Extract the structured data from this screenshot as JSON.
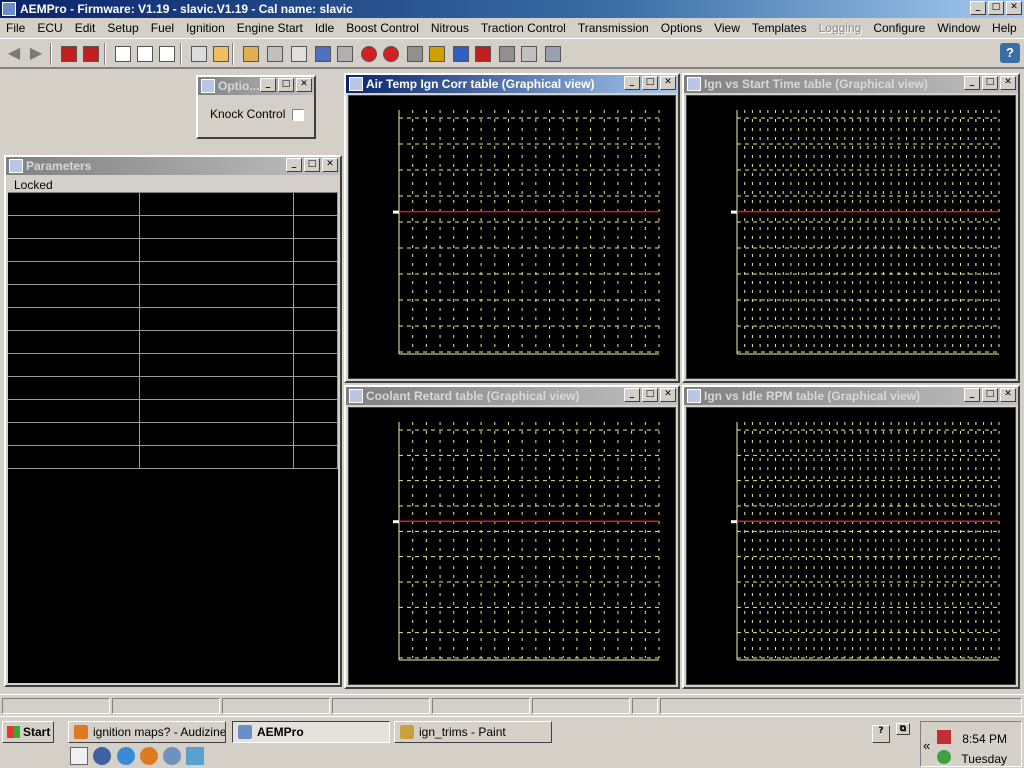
{
  "window": {
    "title": "AEMPro - Firmware: V1.19 - slavic.V1.19 - Cal name: slavic",
    "controls": [
      "_",
      "□",
      "✕"
    ]
  },
  "menu": [
    {
      "label": "File",
      "enabled": true
    },
    {
      "label": "ECU",
      "enabled": true
    },
    {
      "label": "Edit",
      "enabled": true
    },
    {
      "label": "Setup",
      "enabled": true
    },
    {
      "label": "Fuel",
      "enabled": true
    },
    {
      "label": "Ignition",
      "enabled": true
    },
    {
      "label": "Engine Start",
      "enabled": true
    },
    {
      "label": "Idle",
      "enabled": true
    },
    {
      "label": "Boost Control",
      "enabled": true
    },
    {
      "label": "Nitrous",
      "enabled": true
    },
    {
      "label": "Traction Control",
      "enabled": true
    },
    {
      "label": "Transmission",
      "enabled": true
    },
    {
      "label": "Options",
      "enabled": true
    },
    {
      "label": "View",
      "enabled": true
    },
    {
      "label": "Templates",
      "enabled": true
    },
    {
      "label": "Logging",
      "enabled": false
    },
    {
      "label": "Configure",
      "enabled": true
    },
    {
      "label": "Window",
      "enabled": true
    },
    {
      "label": "Help",
      "enabled": true
    }
  ],
  "toolbar": {
    "back_icon": "back-arrow-icon",
    "forward_icon": "forward-arrow-icon",
    "help_label": "?",
    "icon_colors": {
      "accent": "#c02020",
      "tool": "#3060a0"
    }
  },
  "options_window": {
    "title": "Optio...",
    "knock_control_label": "Knock Control",
    "knock_control_checked": false
  },
  "parameters_window": {
    "title": "Parameters",
    "header": "Locked",
    "row_count": 12
  },
  "graphs": [
    {
      "title": "Air Temp Ign Corr table (Graphical view)",
      "active": true
    },
    {
      "title": "Ign vs Start Time table (Graphical view)",
      "active": false
    },
    {
      "title": "Coolant Retard table (Graphical view)",
      "active": false
    },
    {
      "title": "Ign vs Idle RPM table (Graphical view)",
      "active": false
    }
  ],
  "graph_colors": {
    "grid": "#e8e890",
    "axis": "#f0f0b0",
    "line": "#d02020",
    "background": "#000000"
  },
  "taskbar": {
    "start_label": "Start",
    "tasks": [
      {
        "label": "ignition maps? - Audizine ...",
        "icon": "firefox-icon",
        "pressed": false
      },
      {
        "label": "AEMPro",
        "icon": "aempro-icon",
        "pressed": true
      },
      {
        "label": "ign_trims - Paint",
        "icon": "paint-icon",
        "pressed": false
      }
    ],
    "clock_time": "8:54 PM",
    "clock_day": "Tuesday",
    "tray_expand": "«"
  }
}
